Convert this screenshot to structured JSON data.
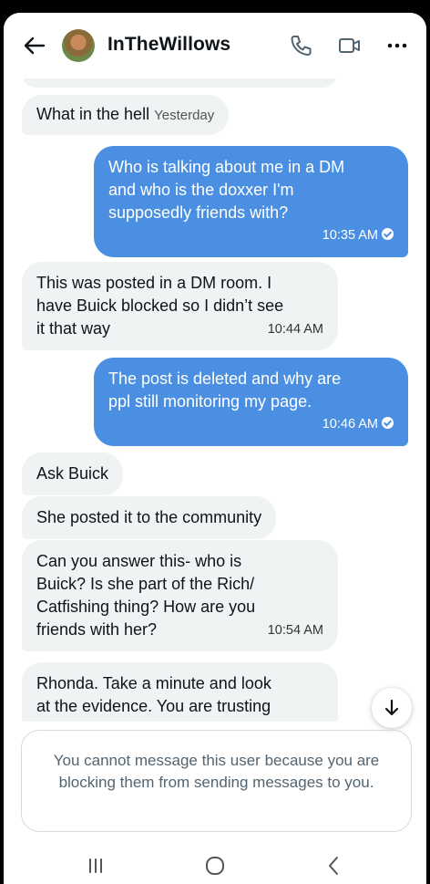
{
  "header": {
    "title": "InTheWillows",
    "icons": [
      "back-arrow-icon",
      "phone-icon",
      "video-icon",
      "more-icon"
    ]
  },
  "messages": [
    {
      "dir": "in",
      "text": "What in the hell",
      "time": "Yesterday"
    },
    {
      "dir": "out",
      "lines": [
        "Who is talking about me in a DM",
        "and who is the doxxer I'm",
        "supposedly friends with?"
      ],
      "time": "10:35 AM"
    },
    {
      "dir": "in",
      "lines": [
        "This was posted in a DM room. I",
        "have Buick blocked so I didn’t see",
        "it that way"
      ],
      "time": "10:44 AM"
    },
    {
      "dir": "out",
      "lines": [
        "The post is deleted and why are",
        "ppl still monitoring my page."
      ],
      "time": "10:46 AM"
    },
    {
      "dir": "in",
      "text": "Ask Buick"
    },
    {
      "dir": "in",
      "text": "She posted it to the community"
    },
    {
      "dir": "in",
      "lines": [
        "Can you answer this- who is",
        "Buick? Is she part of the Rich/",
        "Catfishing thing? How are you",
        "friends with her?"
      ],
      "time": "10:54 AM"
    },
    {
      "dir": "in",
      "lines": [
        "Rhonda. Take a minute and look",
        "at the evidence. You are trusting"
      ]
    }
  ],
  "notice": {
    "text": "You cannot message this user because you are blocking them from sending messages to you."
  },
  "colors": {
    "outgoing_bubble": "#4b8fe2",
    "incoming_bubble": "#eff3f4",
    "notice_text": "#536471"
  }
}
